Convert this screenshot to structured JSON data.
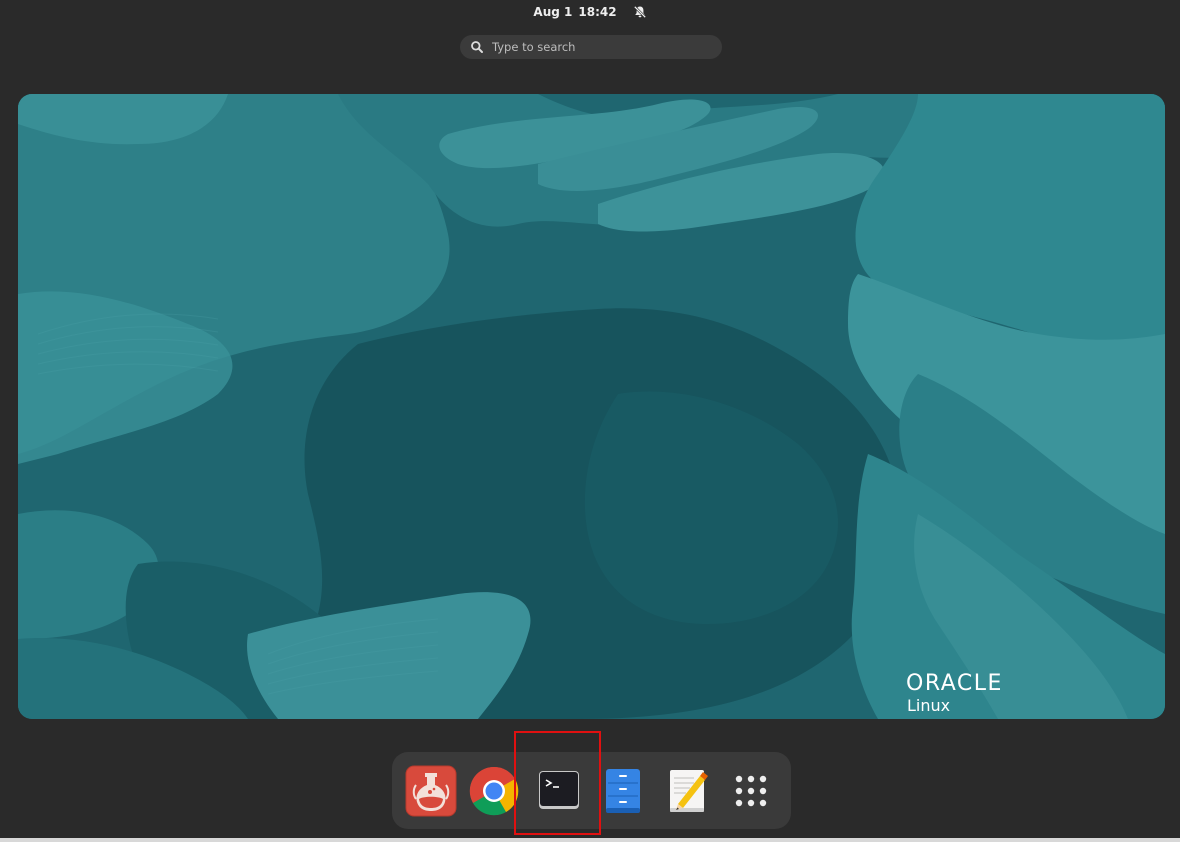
{
  "topbar": {
    "date": "Aug 1",
    "time": "18:42",
    "notification_icon": "bell-muted-icon"
  },
  "search": {
    "placeholder": "Type to search",
    "icon": "search-icon"
  },
  "workspace": {
    "brand_name": "ORACLE",
    "brand_product": "Linux"
  },
  "dash": {
    "items": [
      {
        "name": "Sandbox app",
        "icon": "flask-icon"
      },
      {
        "name": "Google Chrome",
        "icon": "chrome-icon"
      },
      {
        "name": "Terminal",
        "icon": "terminal-icon"
      },
      {
        "name": "Files",
        "icon": "file-cabinet-icon"
      },
      {
        "name": "Text Editor",
        "icon": "text-editor-icon"
      },
      {
        "name": "Show Applications",
        "icon": "app-grid-icon"
      }
    ]
  },
  "colors": {
    "background": "#2a2a2a",
    "wallpaper_base": "#1f6670",
    "highlight": "#e01010"
  }
}
